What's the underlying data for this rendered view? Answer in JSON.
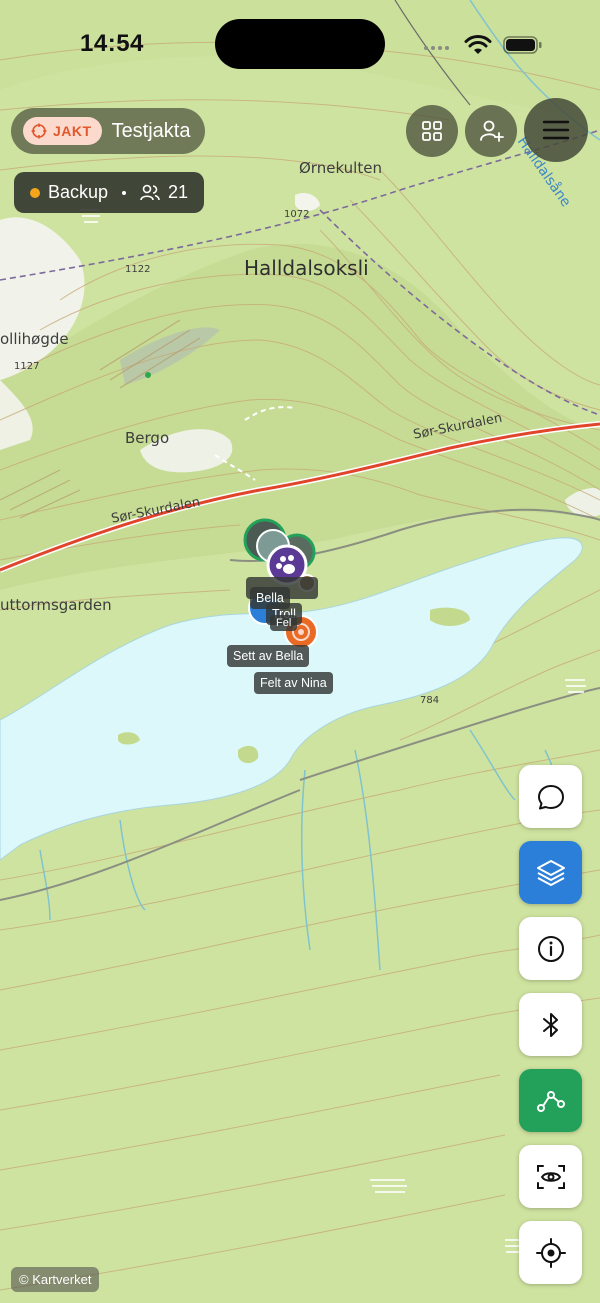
{
  "status_bar": {
    "time": "14:54"
  },
  "header": {
    "hunt_badge": "JAKT",
    "hunt_name": "Testjakta",
    "backup_label": "Backup",
    "participant_count": "21"
  },
  "map": {
    "places": {
      "ornekulten": "Ørnekulten",
      "halldalsoksli": "Halldalsoksli",
      "halldalsane": "Halldalsåne",
      "bollihogde": "ollihøgde",
      "bergo": "Bergo",
      "sor_skurdalen_1": "Sør-Skurdalen",
      "sor_skurdalen_2": "Sør-Skurdalen",
      "uttormsgarden": "uttormsgarden"
    },
    "elevations": [
      "1072",
      "1122",
      "1127",
      "784"
    ],
    "markers": {
      "bella": "Bella",
      "troll": "Troll",
      "fel": "Fel",
      "sett_av_bella": "Sett av Bella",
      "felt_av_nina": "Felt av Nina"
    },
    "attribution": "© Kartverket"
  },
  "colors": {
    "water": "#dcf8fb",
    "terrain": "#cfe3a0",
    "road": "#e0442b",
    "accent_blue": "#2b7fd9",
    "accent_green": "#23a15a",
    "hunt_orange": "#e2572b",
    "backup_dot": "#f4a51c"
  },
  "icons": {
    "top": [
      "grid-icon",
      "add-user-icon",
      "menu-icon"
    ],
    "tools": [
      "chat-icon",
      "layers-icon",
      "info-icon",
      "bluetooth-icon",
      "route-icon",
      "scan-eye-icon",
      "locate-icon"
    ]
  }
}
